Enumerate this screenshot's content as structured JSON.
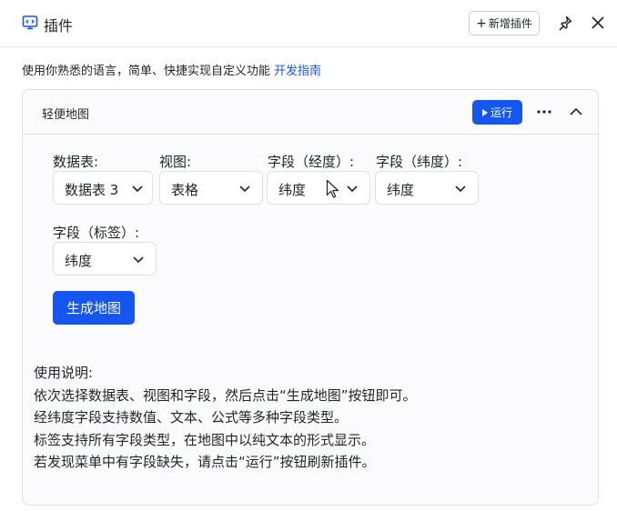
{
  "header": {
    "title": "插件",
    "add_plugin_label": "新增插件"
  },
  "description": {
    "text": "使用你熟悉的语言，简单、快捷实现自定义功能",
    "guide_link": "开发指南"
  },
  "card": {
    "title": "轻便地图",
    "run_label": "运行"
  },
  "form": {
    "fields": [
      {
        "label": "数据表:",
        "value": "数据表 3"
      },
      {
        "label": "视图:",
        "value": "表格"
      },
      {
        "label": "字段（经度）:",
        "value": "纬度"
      },
      {
        "label": "字段（纬度）:",
        "value": "纬度"
      },
      {
        "label": "字段（标签）:",
        "value": "纬度"
      }
    ],
    "generate_label": "生成地图"
  },
  "instructions": [
    "使用说明:",
    "依次选择数据表、视图和字段，然后点击“生成地图”按钮即可。",
    "经纬度字段支持数值、文本、公式等多种字段类型。",
    "标签支持所有字段类型，在地图中以纯文本的形式显示。",
    "若发现菜单中有字段缺失，请点击“运行”按钮刷新插件。"
  ],
  "colors": {
    "accent": "#1456f0",
    "border": "#dee0e3",
    "text": "#1f2329"
  }
}
